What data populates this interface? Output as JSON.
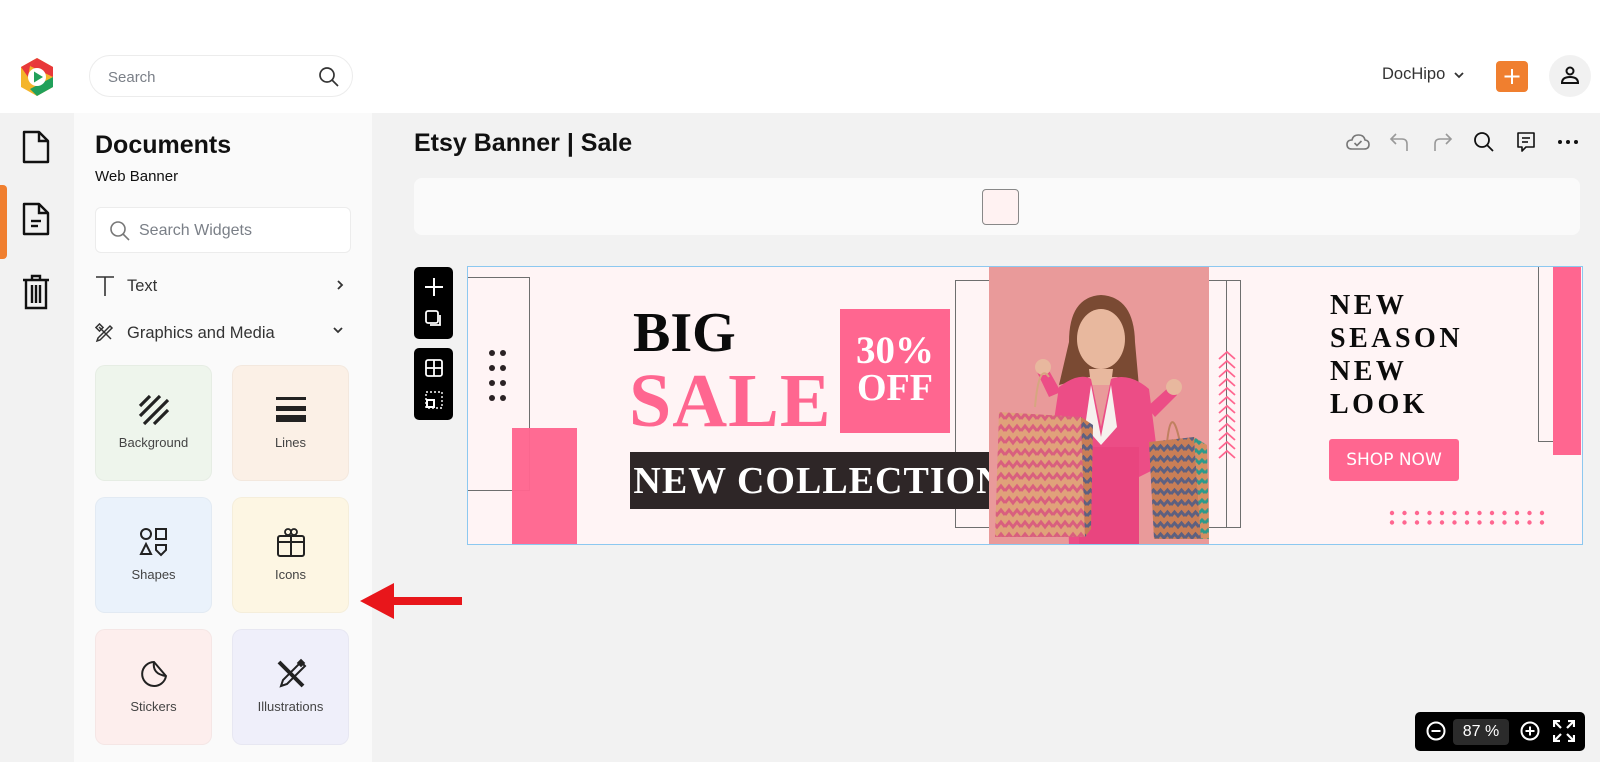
{
  "topbar": {
    "search_placeholder": "Search",
    "workspace_label": "DocHipo",
    "add_button_icon": "plus-icon",
    "avatar_icon": "user-icon"
  },
  "rail": {
    "items": [
      {
        "name": "documents",
        "icon": "document-icon",
        "active": false
      },
      {
        "name": "web-banner",
        "icon": "document-lines-icon",
        "active": true
      },
      {
        "name": "trash",
        "icon": "trash-icon",
        "active": false
      }
    ]
  },
  "panel": {
    "title": "Documents",
    "subtitle": "Web Banner",
    "search_placeholder": "Search Widgets",
    "categories": [
      {
        "label": "Text",
        "icon": "text-icon",
        "state": "collapsed"
      },
      {
        "label": "Graphics and Media",
        "icon": "graphics-icon",
        "state": "expanded"
      }
    ],
    "tiles": [
      {
        "label": "Background",
        "icon": "stripes-icon",
        "color": "#eef5ec"
      },
      {
        "label": "Lines",
        "icon": "lines-icon",
        "color": "#fbf0e6"
      },
      {
        "label": "Shapes",
        "icon": "shapes-icon",
        "color": "#eaf2fb"
      },
      {
        "label": "Icons",
        "icon": "gift-icon",
        "color": "#fdf6e3"
      },
      {
        "label": "Stickers",
        "icon": "sticker-icon",
        "color": "#fdeeed"
      },
      {
        "label": "Illustrations",
        "icon": "pen-ruler-icon",
        "color": "#efeffa"
      }
    ]
  },
  "main": {
    "doc_title": "Etsy Banner | Sale",
    "toolbar": [
      "cloud-saved-icon",
      "undo-icon",
      "redo-icon",
      "search-icon",
      "comment-icon",
      "more-icon"
    ],
    "page_count": 1
  },
  "banner": {
    "big": "BIG",
    "sale": "SALE",
    "discount_line1": "30%",
    "discount_line2": "OFF",
    "collection": "NEW COLLECTION",
    "tagline": [
      "NEW",
      "SEASON",
      "NEW",
      "LOOK"
    ],
    "cta": "SHOP NOW",
    "accent_color": "#ff6690",
    "dark_color": "#2e2627"
  },
  "zoom": {
    "value": "87",
    "unit": "%"
  }
}
